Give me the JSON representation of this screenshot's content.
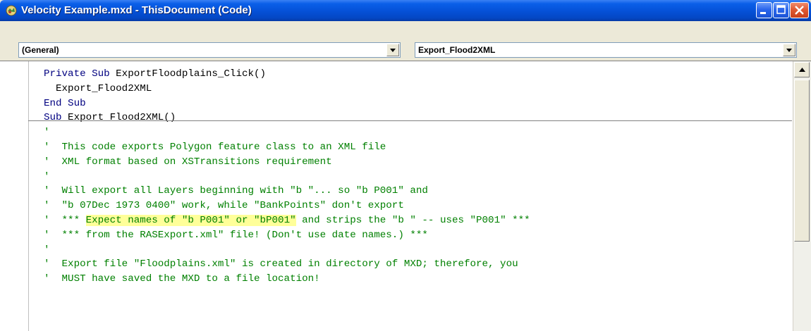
{
  "window": {
    "title": "Velocity Example.mxd - ThisDocument (Code)",
    "icon": "arcmap-icon",
    "controls": [
      "minimize-icon",
      "maximize-icon",
      "close-icon"
    ]
  },
  "combos": {
    "object": "(General)",
    "procedure": "Export_Flood2XML"
  },
  "code_lines": [
    [
      {
        "t": "Private Sub",
        "c": "kw"
      },
      {
        "t": " ExportFloodplains_Click()",
        "c": ""
      }
    ],
    [
      {
        "t": "  Export_Flood2XML",
        "c": ""
      }
    ],
    [
      {
        "t": "End Sub",
        "c": "kw"
      }
    ],
    [
      {
        "t": "Sub",
        "c": "kw"
      },
      {
        "t": " Export_Flood2XML()",
        "c": ""
      }
    ],
    [
      {
        "t": "'",
        "c": "cm"
      }
    ],
    [
      {
        "t": "'  This code exports Polygon feature class to an XML file",
        "c": "cm"
      }
    ],
    [
      {
        "t": "'  XML format based on XSTransitions requirement",
        "c": "cm"
      }
    ],
    [
      {
        "t": "'",
        "c": "cm"
      }
    ],
    [
      {
        "t": "'  Will export all Layers beginning with \"b \"... so \"b P001\" and",
        "c": "cm"
      }
    ],
    [
      {
        "t": "'  \"b 07Dec 1973 0400\" work, while \"BankPoints\" don't export",
        "c": "cm"
      }
    ],
    [
      {
        "t": "'  *** ",
        "c": "cm"
      },
      {
        "t": "Expect names of \"b P001\" or \"bP001\"",
        "c": "cm hl"
      },
      {
        "t": " and strips the \"b \" -- uses \"P001\" ***",
        "c": "cm"
      }
    ],
    [
      {
        "t": "'  *** from the RASExport.xml\" file! (Don't use date names.) ***",
        "c": "cm"
      }
    ],
    [
      {
        "t": "'",
        "c": "cm"
      }
    ],
    [
      {
        "t": "'  Export file \"Floodplains.xml\" is created in directory of MXD; therefore, you",
        "c": "cm"
      }
    ],
    [
      {
        "t": "'  MUST have saved the MXD to a file location!",
        "c": "cm"
      }
    ]
  ],
  "scrollbar": {
    "position": 0.0
  }
}
